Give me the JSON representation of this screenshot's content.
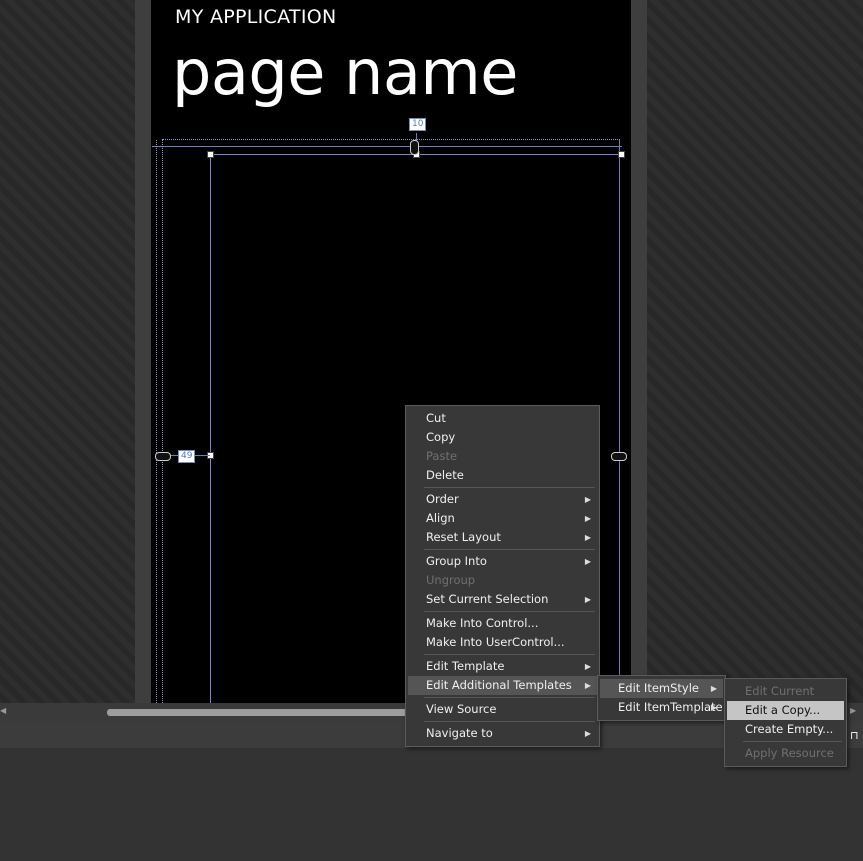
{
  "designer": {
    "app_title": "MY APPLICATION",
    "page_title": "page name",
    "top_margin_badge": "10",
    "left_margin_badge": "49"
  },
  "context_menu": {
    "items": [
      {
        "label": "Cut",
        "enabled": true,
        "submenu": false
      },
      {
        "label": "Copy",
        "enabled": true,
        "submenu": false
      },
      {
        "label": "Paste",
        "enabled": false,
        "submenu": false
      },
      {
        "label": "Delete",
        "enabled": true,
        "submenu": false
      },
      {
        "label": "Order",
        "enabled": true,
        "submenu": true
      },
      {
        "label": "Align",
        "enabled": true,
        "submenu": true
      },
      {
        "label": "Reset Layout",
        "enabled": true,
        "submenu": true
      },
      {
        "label": "Group Into",
        "enabled": true,
        "submenu": true
      },
      {
        "label": "Ungroup",
        "enabled": false,
        "submenu": false
      },
      {
        "label": "Set Current Selection",
        "enabled": true,
        "submenu": true
      },
      {
        "label": "Make Into Control...",
        "enabled": true,
        "submenu": false
      },
      {
        "label": "Make Into UserControl...",
        "enabled": true,
        "submenu": false
      },
      {
        "label": "Edit Template",
        "enabled": true,
        "submenu": true
      },
      {
        "label": "Edit Additional Templates",
        "enabled": true,
        "submenu": true,
        "highlighted": true
      },
      {
        "label": "View Source",
        "enabled": true,
        "submenu": false
      },
      {
        "label": "Navigate to",
        "enabled": true,
        "submenu": true
      }
    ]
  },
  "templates_submenu": {
    "items": [
      {
        "label": "Edit ItemStyle",
        "highlighted": true
      },
      {
        "label": "Edit ItemTemplate",
        "highlighted": false
      }
    ]
  },
  "itemstyle_submenu": {
    "items": [
      {
        "label": "Edit Current",
        "enabled": false
      },
      {
        "label": "Edit a Copy...",
        "enabled": true,
        "highlighted": true
      },
      {
        "label": "Create Empty...",
        "enabled": true
      },
      {
        "label": "Apply Resource",
        "enabled": false
      }
    ]
  },
  "icons": {
    "submenu_arrow": "▶",
    "scroll_left": "◀",
    "scroll_right": "▶",
    "pin": "⊓"
  },
  "colors": {
    "menu_bg": "#383838",
    "highlight": "#555555",
    "highlight_light": "#c5c5c5",
    "guide": "#6a7cc7"
  }
}
